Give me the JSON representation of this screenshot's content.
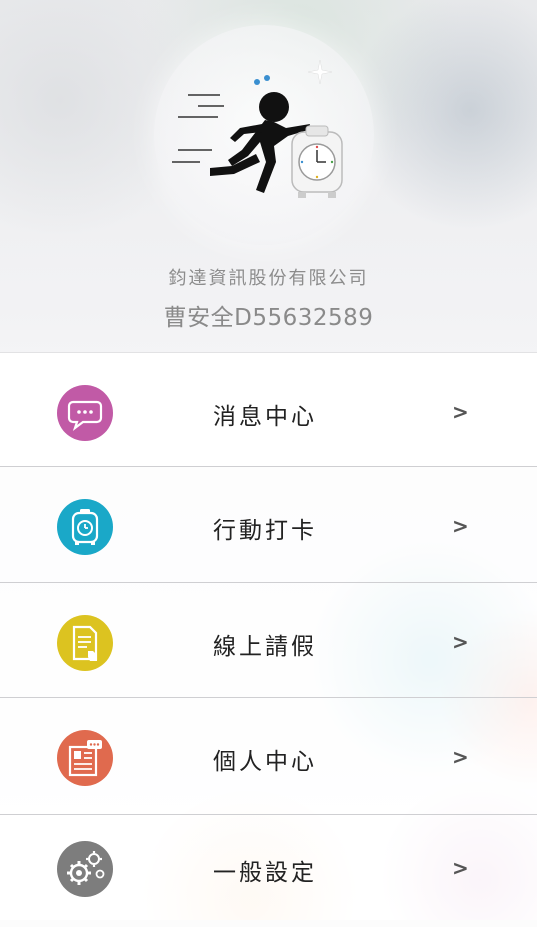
{
  "header": {
    "company_name": "鈞達資訊股份有限公司",
    "user_line": "曹安全D55632589"
  },
  "menu": {
    "items": [
      {
        "label": "消息中心",
        "icon": "chat-bubble-icon",
        "color": "#c15aa6"
      },
      {
        "label": "行動打卡",
        "icon": "time-clock-icon",
        "color": "#1aa8c8"
      },
      {
        "label": "線上請假",
        "icon": "document-hand-icon",
        "color": "#dcc320"
      },
      {
        "label": "個人中心",
        "icon": "profile-card-icon",
        "color": "#e06a4e"
      },
      {
        "label": "一般設定",
        "icon": "gears-icon",
        "color": "#7d7d7d"
      }
    ],
    "chevron": ">"
  },
  "colors": {
    "company_text": "#8c8c8c",
    "label_text": "#222222"
  }
}
